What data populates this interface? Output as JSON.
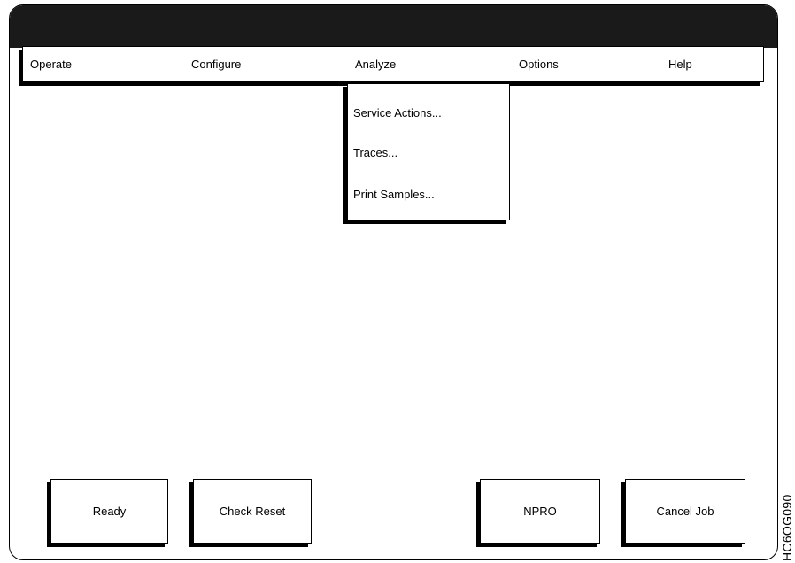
{
  "menubar": {
    "items": [
      {
        "label": "Operate"
      },
      {
        "label": "Configure"
      },
      {
        "label": "Analyze"
      },
      {
        "label": "Options"
      },
      {
        "label": "Help"
      }
    ]
  },
  "dropdown": {
    "items": [
      {
        "label": "Service Actions..."
      },
      {
        "label": "Traces..."
      },
      {
        "label": "Print Samples..."
      }
    ]
  },
  "buttons": {
    "ready": "Ready",
    "check_reset": "Check Reset",
    "npro": "NPRO",
    "cancel_job": "Cancel Job"
  },
  "figure_id": "HC6OG090",
  "colors": {
    "titlebar": "#1a1a1a",
    "background": "#ffffff",
    "outline": "#000000"
  }
}
